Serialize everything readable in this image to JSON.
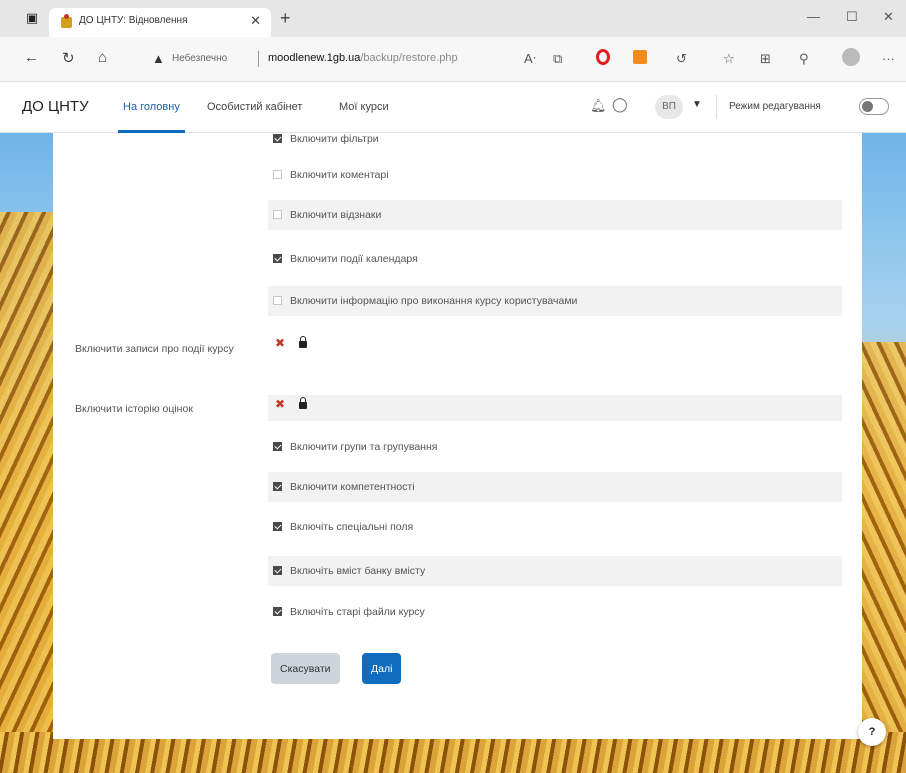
{
  "browser": {
    "tab_title": "ДО ЦНТУ: Відновлення",
    "tab_close": "✕",
    "new_tab": "+",
    "insecure_label": "Небезпечно",
    "url_host": "moodlenew.1gb.ua",
    "url_path": "/backup/restore.php",
    "window_minimize": "—",
    "window_maximize": "☐",
    "window_close": "✕"
  },
  "navbar": {
    "brand": "ДО ЦНТУ",
    "links": [
      "На головну",
      "Особистий кабінет",
      "Мої курси"
    ],
    "user_initials": "ВП",
    "edit_mode_label": "Режим редагування"
  },
  "form": {
    "rows": [
      {
        "label": "Включити фільтри",
        "checked": true
      },
      {
        "label": "Включити коментарі",
        "checked": false
      },
      {
        "label": "Включити відзнаки",
        "checked": false
      },
      {
        "label": "Включити події календаря",
        "checked": true
      },
      {
        "label": "Включити інформацію про виконання курсу користувачами",
        "checked": false
      },
      {
        "label": "Включити групи та групування",
        "checked": true
      },
      {
        "label": "Включити компетентності",
        "checked": true
      },
      {
        "label": "Включіть спеціальні поля",
        "checked": true
      },
      {
        "label": "Включіть вміст банку вмісту",
        "checked": true
      },
      {
        "label": "Включіть старі файли курсу",
        "checked": true
      }
    ],
    "locked_settings": [
      {
        "label": "Включити записи про події курсу"
      },
      {
        "label": "Включити історію оцінок"
      }
    ],
    "cancel_label": "Скасувати",
    "submit_label": "Далі"
  },
  "help_label": "?"
}
